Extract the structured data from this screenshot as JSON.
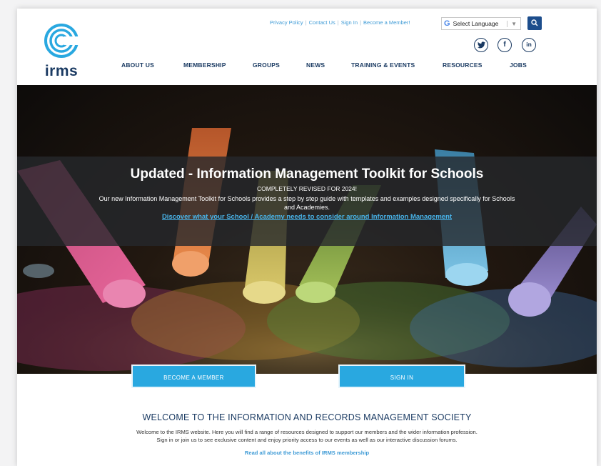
{
  "header": {
    "logo_text": "irms",
    "top_links": [
      "Privacy Policy",
      "Contact Us",
      "Sign In",
      "Become a Member!"
    ],
    "language_select": "Select Language",
    "nav": [
      "ABOUT US",
      "MEMBERSHIP",
      "GROUPS",
      "NEWS",
      "TRAINING & EVENTS",
      "RESOURCES",
      "JOBS"
    ]
  },
  "social": [
    {
      "name": "twitter",
      "glyph": "t"
    },
    {
      "name": "facebook",
      "glyph": "f"
    },
    {
      "name": "linkedin",
      "glyph": "in"
    }
  ],
  "hero": {
    "title": "Updated - Information Management Toolkit for Schools",
    "subtitle": "COMPLETELY REVISED FOR 2024!",
    "description": "Our new Information Management Toolkit for Schools provides a step by step guide with templates and examples designed specifically for Schools and Academies.",
    "link": "Discover what your School / Academy needs to consider around Information Management"
  },
  "cta": {
    "become_member": "BECOME A MEMBER",
    "sign_in": "SIGN IN"
  },
  "welcome": {
    "title": "WELCOME TO THE INFORMATION AND RECORDS MANAGEMENT SOCIETY",
    "line1": "Welcome to the IRMS website. Here you will find a range of resources designed to support our members and the wider information profession.",
    "line2": "Sign in or join us to see exclusive content and enjoy priority access to our events as well as our interactive discussion forums.",
    "link": "Read all about the benefits of IRMS membership"
  },
  "colors": {
    "brand_navy": "#1a3a62",
    "brand_blue": "#29a8e0",
    "link_blue": "#3f9bd6"
  }
}
